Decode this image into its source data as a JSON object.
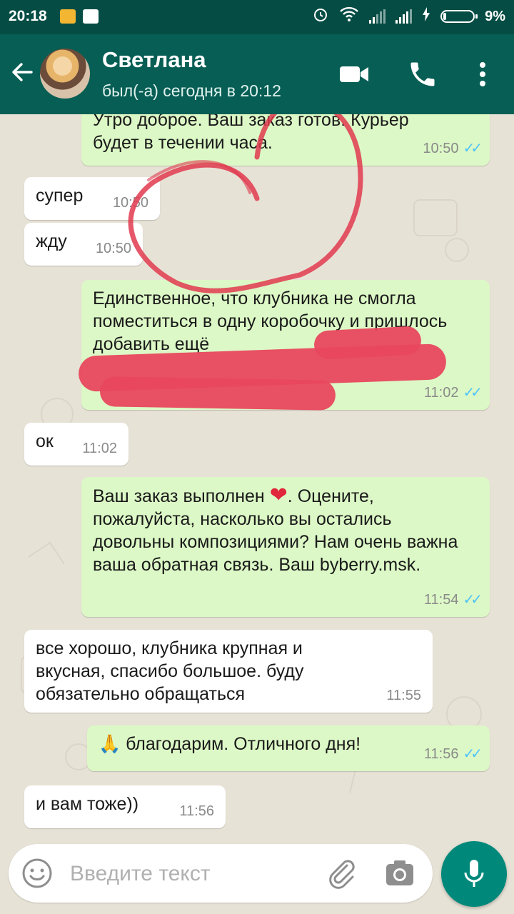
{
  "status_bar": {
    "time": "20:18",
    "battery_text": "9%",
    "battery_level": 0.09
  },
  "header": {
    "contact_name": "Светлана",
    "last_seen": "был(-а) сегодня в 20:12"
  },
  "messages": [
    {
      "direction": "out",
      "text": "Утро доброе. Ваш заказ готов. Курьер будет в течении часа.",
      "time": "10:50",
      "status": "read"
    },
    {
      "direction": "in",
      "text": "супер",
      "time": "10:50"
    },
    {
      "direction": "in",
      "text": "жду",
      "time": "10:50"
    },
    {
      "direction": "out",
      "text": "Единственное, что клубника не смогла поместиться в одну коробочку и пришлось добавить ещё",
      "time": "11:02",
      "status": "read"
    },
    {
      "direction": "in",
      "text": "ок",
      "time": "11:02"
    },
    {
      "direction": "out",
      "text_before_emoji": "Ваш заказ выполнен ",
      "text_after_emoji": ". Оцените, пожалуйста, насколько вы остались довольны композициями? Нам очень важна ваша обратная связь. Ваш byberry.msk.",
      "emoji": "red-heart",
      "time": "11:54",
      "status": "read"
    },
    {
      "direction": "in",
      "text": "все хорошо, клубника крупная и вкусная, спасибо большое. буду обязательно обращаться",
      "time": "11:55"
    },
    {
      "direction": "out",
      "emoji": "folded-hands",
      "text": "благодарим. Отличного дня!",
      "time": "11:56",
      "status": "read"
    },
    {
      "direction": "in",
      "text": "и вам тоже))",
      "time": "11:56"
    }
  ],
  "input": {
    "placeholder": "Введите текст"
  },
  "icons": {
    "back": "arrow-left-icon",
    "video": "video-camera-icon",
    "call": "phone-icon",
    "menu": "more-vert-icon",
    "emoji": "emoji-icon",
    "attach": "paperclip-icon",
    "camera": "camera-icon",
    "mic": "mic-icon"
  },
  "colors": {
    "header": "#075e54",
    "status_bar": "#054d44",
    "outgoing_bubble": "#dcf8c6",
    "incoming_bubble": "#ffffff",
    "read_ticks": "#4fc3f7",
    "mic_button": "#00897b",
    "heart_drawing": "#e03a4f"
  }
}
